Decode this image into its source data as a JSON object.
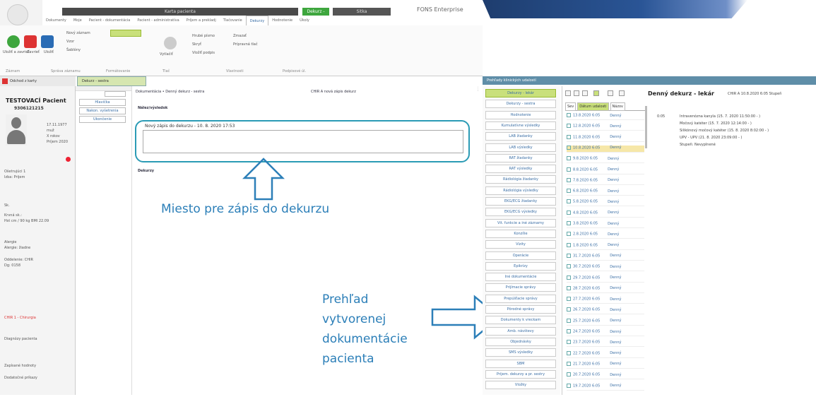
{
  "app": {
    "title": "FONS Enterprise"
  },
  "ribbon": {
    "context_tabs": [
      "Karta pacienta",
      "Dekurz - sestra",
      "Sitka"
    ],
    "tabs": [
      "Dokumenty",
      "Moje",
      "Pacient - dokumentácia",
      "Pacient - administratíva",
      "Príjem a prekladj",
      "Tlačovanie",
      "Dekurzy",
      "Hodnotenie",
      "Úkoly"
    ],
    "active_tab": "Dekurzy",
    "buttons": {
      "save_close": "Uložiť a zavrieť",
      "close": "Zavrieť",
      "save": "Uložiť",
      "new": "Nový záznam",
      "templates": "Šablóny",
      "undo": "Vzor",
      "print": "Vytlačiť",
      "prev_print": "Prípravná tlač",
      "font_bold": "Hrubé písmo",
      "hide": "Skryť",
      "remove": "Zmazať",
      "insert_signature": "Vložiť podpis"
    },
    "group_labels": [
      "Záznam",
      "Správa záznamu",
      "Formátovanie",
      "Tlač",
      "Vlastnosti",
      "Podpisové úl."
    ]
  },
  "left_panel": {
    "header": "Odchod z karty",
    "patient_name": "TESTOVACÍ Pacient",
    "patient_id": "9306121215",
    "info_lines": [
      "17.11.1977",
      "muž",
      "X rokov",
      "Príjem 2020"
    ],
    "details": [
      "Ošetrujúci 1",
      "Izba: Prijem",
      "Sk.      ",
      "Krvná sk.:",
      "Hst cm / 90 kg BMI 22.09",
      "Alergie",
      "Alergie: žiadne",
      "Oddelenie: CHIR",
      "Dg: 0158",
      "CHIR 1 - Chirurgia",
      "Diagnózy pacienta",
      "Zapísané hodnoty",
      "Dodatočné príkazy"
    ]
  },
  "middle": {
    "tab_label": "Dekurz - sestra",
    "nav_buttons": [
      "Hlavička",
      "Nakon. vyšetrenia",
      "Ukončenie"
    ],
    "breadcrumb": "Dokumentácia • Denný dekurz - sestra",
    "breadcrumb_right": "CHIR A    nová zápis dekurz",
    "section1": "Nález/výsledok",
    "entry_text": "Nový zápis do dekurzu - 10. 8. 2020 17:53",
    "section2": "Dekurzy"
  },
  "callouts": {
    "entry_place": "Miesto pre zápis do dekurzu",
    "overview_lines": [
      "Prehľad",
      "vytvorenej",
      "dokumentácie",
      "pacienta"
    ]
  },
  "right_panel": {
    "header": "Prehľady klinických udalostí",
    "list": [
      "Dekurzy - lekár",
      "Dekurzy - sestra",
      "Hodnotenie",
      "Kumulatívne výsledky",
      "LAB žiadanky",
      "LAB výsledky",
      "RAT žiadanky",
      "RAT výsledky",
      "Rádiológia žiadanky",
      "Rádiológia výsledky",
      "EKG/ECG žiadanky",
      "EKG/ECG výsledky",
      "Vit. funkcie a iné záznamy",
      "Konzílie",
      "Vizity",
      "Operácie",
      "Epikrízy",
      "Iné dokumentácie",
      "Prijímacie správy",
      "Prepúšťacie správy",
      "Pôrodné správy",
      "Dokumenty k vreckam",
      "Amb. návštevy",
      "Objednávky",
      "SMS výsledky",
      "SBM",
      "Prijem. dekurzy a pr. sestry",
      "Vložky"
    ],
    "selected": "Dekurzy - lekár",
    "grid_headers": [
      "Sev",
      "Dátum udalosti",
      "Názov"
    ],
    "grid_rows": [
      "13.8.2020 6:05",
      "12.8.2020 6:05",
      "11.8.2020 6:05",
      "10.8.2020 6:05",
      "9.8.2020 6:05",
      "8.8.2020 6:05",
      "7.8.2020 6:05",
      "6.8.2020 6:05",
      "5.8.2020 6:05",
      "4.8.2020 6:05",
      "3.8.2020 6:05",
      "2.8.2020 6:05",
      "1.8.2020 6:05",
      "31.7.2020 6:05",
      "30.7.2020 6:05",
      "29.7.2020 6:05",
      "28.7.2020 6:05",
      "27.7.2020 6:05",
      "26.7.2020 6:05",
      "25.7.2020 6:05",
      "24.7.2020 6:05",
      "23.7.2020 6:05",
      "22.7.2020 6:05",
      "21.7.2020 6:05",
      "20.7.2020 6:05",
      "19.7.2020 6:05"
    ],
    "grid_row_name": "Denný",
    "selected_row": "10.8.2020 6:05",
    "detail_title": "Denný dekurz - lekár",
    "detail_sub": "CHIR A  10.8.2020 6:05  Stupeň",
    "detail_code": "0:05",
    "detail_lines": [
      "Intravenózna kanyla (15. 7. 2020 11:50:00 - )",
      "Močový katéter (15. 7. 2020 12:14:00 - )",
      "Silikónový močový katéter (15. 8. 2020 8:02:00 - )",
      "UPV - UPV (21. 8. 2020 23:09:00 - )",
      "Stupeň: Nevyplnené"
    ]
  },
  "colors": {
    "accent": "#2c7fb8",
    "green": "#c9e07b",
    "box_border": "#2b9bb5"
  }
}
